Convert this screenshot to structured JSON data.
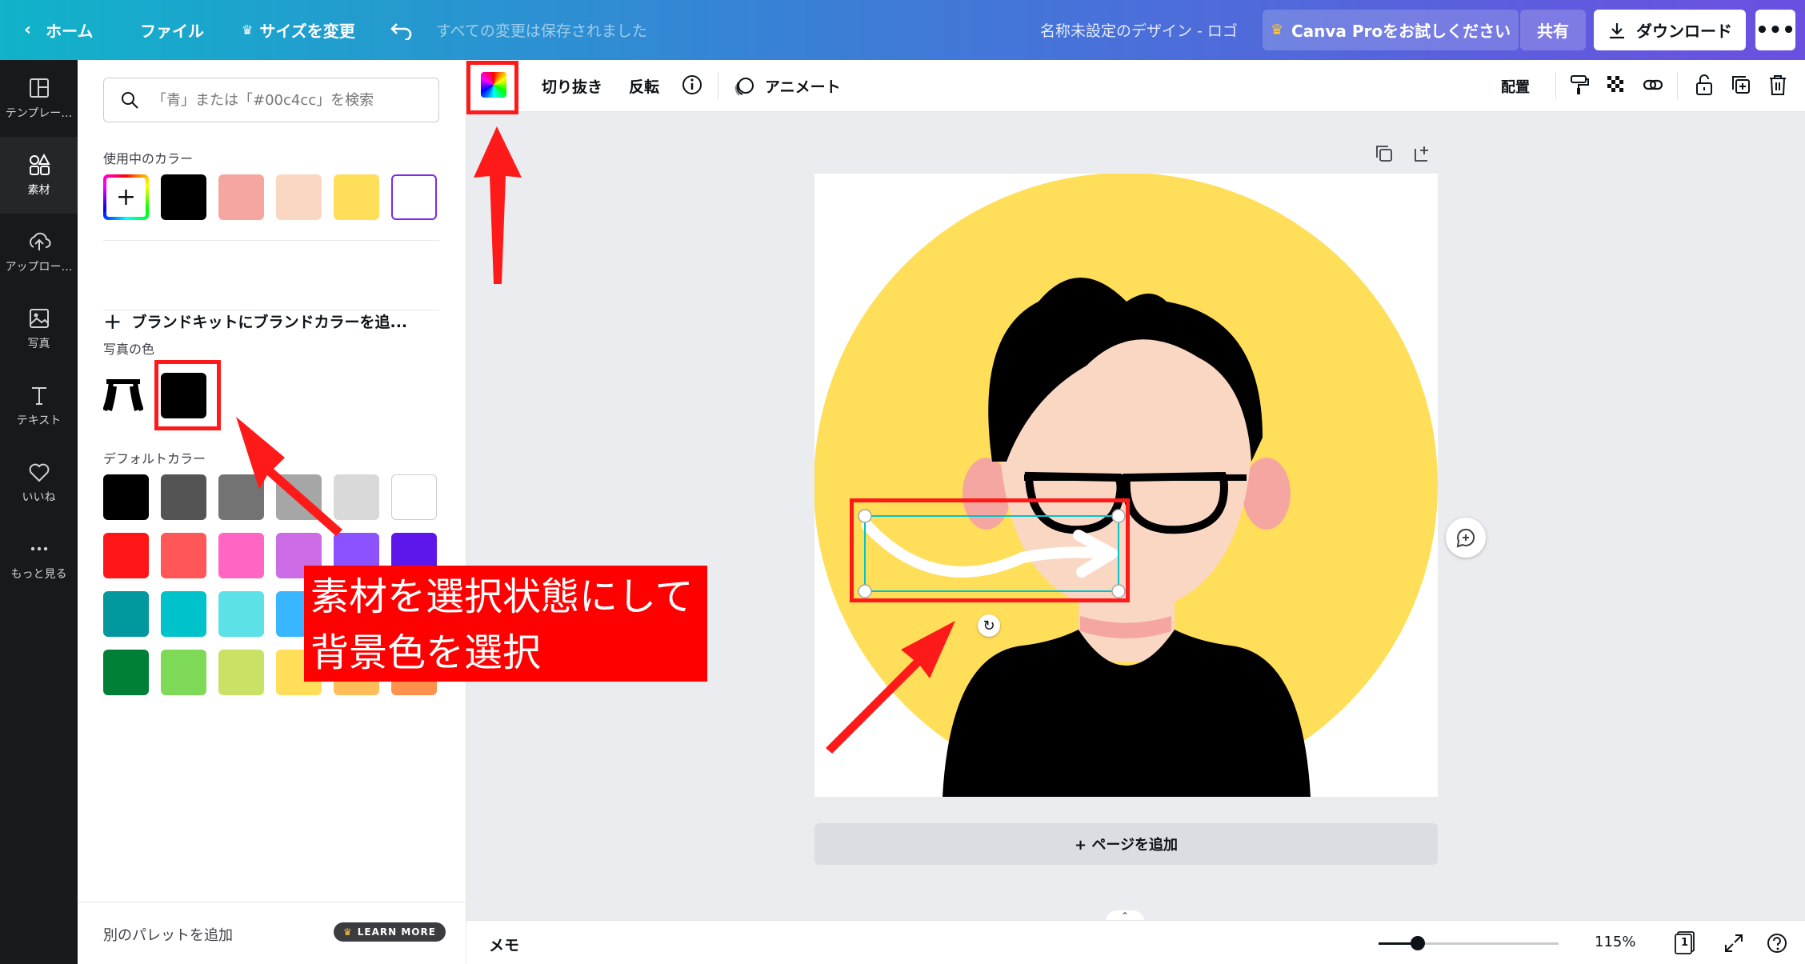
{
  "topbar": {
    "home": "ホーム",
    "file": "ファイル",
    "resize": "サイズを変更",
    "saved_status": "すべての変更は保存されました",
    "design_title": "名称未設定のデザイン - ロゴ",
    "pro_button": "Canva Proをお試しください",
    "share": "共有",
    "download": "ダウンロード",
    "more": "•••"
  },
  "rail": [
    {
      "label": "テンプレー…",
      "icon": "template-icon"
    },
    {
      "label": "素材",
      "icon": "elements-icon"
    },
    {
      "label": "アップロー…",
      "icon": "upload-icon"
    },
    {
      "label": "写真",
      "icon": "photo-icon"
    },
    {
      "label": "テキスト",
      "icon": "text-icon"
    },
    {
      "label": "いいね",
      "icon": "heart-icon"
    },
    {
      "label": "もっと見る",
      "icon": "more-icon"
    }
  ],
  "panel": {
    "search_placeholder": "「青」または「#00c4cc」を検索",
    "in_use_label": "使用中のカラー",
    "in_use_colors": [
      "#000000",
      "#f6a6a0",
      "#fad7c3",
      "#ffde59",
      "#ffffff"
    ],
    "brand_add": "ブランドキットにブランドカラーを追...",
    "photo_colors_label": "写真の色",
    "photo_colors": [
      "#000000"
    ],
    "default_label": "デフォルトカラー",
    "default_colors": [
      [
        "#000000",
        "#545454",
        "#737373",
        "#a6a6a6",
        "#d9d9d9",
        "#ffffff"
      ],
      [
        "#ff1616",
        "#ff5757",
        "#ff66c4",
        "#cb6ce6",
        "#8c52ff",
        "#5e17eb"
      ],
      [
        "#03989e",
        "#00c2cb",
        "#5ce1e6",
        "#38b6ff",
        "#5271ff",
        "#004aad"
      ],
      [
        "#008037",
        "#7ed957",
        "#c9e265",
        "#ffde59",
        "#ffbd59",
        "#ff914d"
      ]
    ],
    "footer_text": "別のパレットを追加",
    "learn_more": "LEARN MORE"
  },
  "toolbar": {
    "crop": "切り抜き",
    "flip": "反転",
    "animate": "アニメート",
    "position": "配置"
  },
  "canvas": {
    "add_page": "+ ページを追加"
  },
  "bottombar": {
    "memo": "メモ",
    "zoom": "115%",
    "page_count": "1"
  },
  "annotation": {
    "line1": "素材を選択状態にして",
    "line2": "背景色を選択"
  },
  "colors": {
    "accent": "#7d2ae8",
    "annotation_red": "#ff0000",
    "selection": "#00c4cc"
  }
}
